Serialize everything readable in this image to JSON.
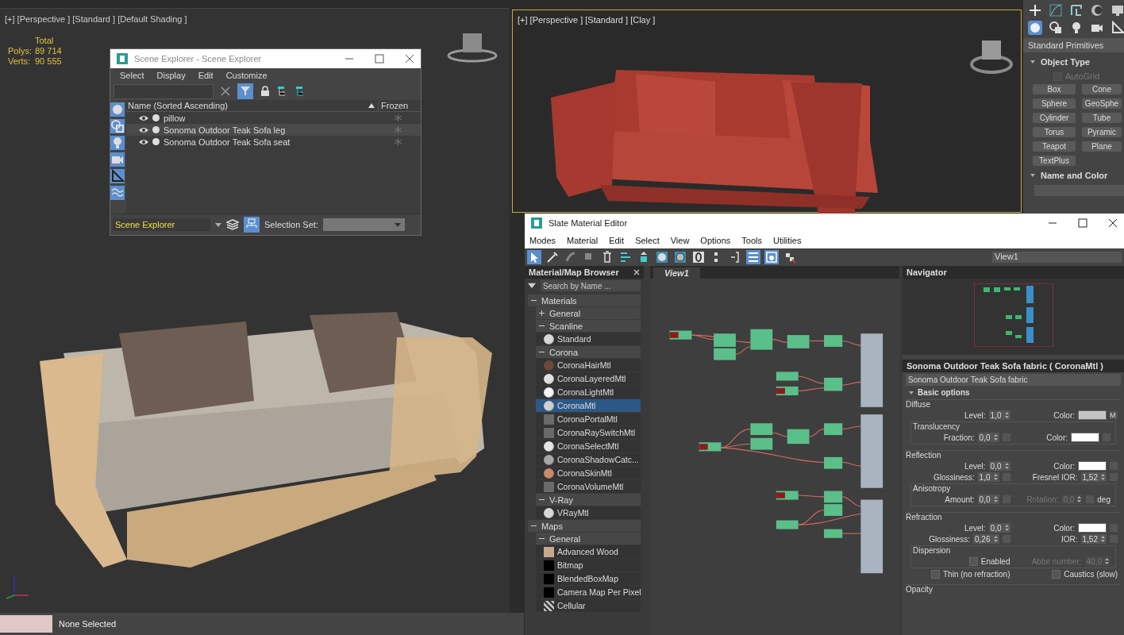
{
  "viewports": [
    {
      "label": "[+] [Perspective ] [Standard ] [Default Shading ]",
      "active": false
    },
    {
      "label": "[+] [Perspective ] [Standard ] [Clay ]",
      "active": true
    }
  ],
  "stats": {
    "heading": "Total",
    "rows": [
      {
        "label": "Polys:",
        "value": "89 714"
      },
      {
        "label": "Verts:",
        "value": "90 555"
      }
    ]
  },
  "scene_explorer": {
    "title": "Scene Explorer - Scene Explorer",
    "menu": [
      "Select",
      "Display",
      "Edit",
      "Customize"
    ],
    "filter_active": true,
    "columns": [
      "Name (Sorted Ascending)",
      "Frozen"
    ],
    "rows": [
      {
        "name": "pillow",
        "selected": false
      },
      {
        "name": "Sonoma Outdoor Teak Sofa leg",
        "selected": true
      },
      {
        "name": "Sonoma Outdoor Teak Sofa seat",
        "selected": false
      }
    ],
    "explorer_name": "Scene Explorer",
    "selection_set_label": "Selection Set:"
  },
  "command_panel": {
    "dropdown": "Standard Primitives",
    "object_type": {
      "title": "Object Type",
      "expanded": true,
      "autogrid": {
        "label": "AutoGrid",
        "checked": false,
        "disabled": true
      },
      "buttons": [
        "Box",
        "Cone",
        "Sphere",
        "GeoSphe",
        "Cylinder",
        "Tube",
        "Torus",
        "Pyramic",
        "Teapot",
        "Plane",
        "TextPlus"
      ]
    },
    "name_and_color": {
      "title": "Name and Color",
      "expanded": true
    }
  },
  "slate": {
    "title": "Slate Material Editor",
    "menu": [
      "Modes",
      "Material",
      "Edit",
      "Select",
      "View",
      "Options",
      "Tools",
      "Utilities"
    ],
    "view_dropdown": "View1",
    "browser": {
      "title": "Material/Map Browser",
      "search_placeholder": "Search by Name ...",
      "sections": [
        {
          "label": "Materials",
          "expanded": true,
          "groups": [
            {
              "label": "General",
              "expanded": false
            },
            {
              "label": "Scanline",
              "expanded": true,
              "items": [
                {
                  "name": "Standard",
                  "kind": "sphere",
                  "color": "#d8d8d8",
                  "selected": false
                }
              ]
            },
            {
              "label": "Corona",
              "expanded": true,
              "items": [
                {
                  "name": "CoronaHairMtl",
                  "kind": "sphere",
                  "color": "#6b4a3a",
                  "selected": false
                },
                {
                  "name": "CoronaLayeredMtl",
                  "kind": "sphere",
                  "color": "#e0e0e0",
                  "selected": false
                },
                {
                  "name": "CoronaLightMtl",
                  "kind": "sphere",
                  "color": "#f4f4f4",
                  "selected": false
                },
                {
                  "name": "CoronaMtl",
                  "kind": "sphere",
                  "color": "#d0d0d0",
                  "selected": true
                },
                {
                  "name": "CoronaPortalMtl",
                  "kind": "flat",
                  "color": "#6a6a6a",
                  "selected": false
                },
                {
                  "name": "CoronaRaySwitchMtl",
                  "kind": "flat",
                  "color": "#6a6a6a",
                  "selected": false
                },
                {
                  "name": "CoronaSelectMtl",
                  "kind": "sphere",
                  "color": "#e4e4e4",
                  "selected": false
                },
                {
                  "name": "CoronaShadowCatc...",
                  "kind": "sphere",
                  "color": "#a8a8a8",
                  "selected": false
                },
                {
                  "name": "CoronaSkinMtl",
                  "kind": "sphere",
                  "color": "#c98a6a",
                  "selected": false
                },
                {
                  "name": "CoronaVolumeMtl",
                  "kind": "flat",
                  "color": "#6a6a6a",
                  "selected": false
                }
              ]
            },
            {
              "label": "V-Ray",
              "expanded": true,
              "items": [
                {
                  "name": "VRayMtl",
                  "kind": "sphere",
                  "color": "#d8d8d8",
                  "selected": false
                }
              ]
            }
          ]
        },
        {
          "label": "Maps",
          "expanded": true,
          "groups": [
            {
              "label": "General",
              "expanded": true,
              "items": [
                {
                  "name": "Advanced Wood",
                  "kind": "flat",
                  "color": "#c8a88a",
                  "selected": false
                },
                {
                  "name": "Bitmap",
                  "kind": "flat",
                  "color": "#000000",
                  "selected": false
                },
                {
                  "name": "BlendedBoxMap",
                  "kind": "flat",
                  "color": "#000000",
                  "selected": false
                },
                {
                  "name": "Camera Map Per Pixel",
                  "kind": "flat",
                  "color": "#000000",
                  "selected": false
                },
                {
                  "name": "Cellular",
                  "kind": "checker",
                  "color": "#bbbbbb",
                  "selected": false
                }
              ]
            }
          ]
        }
      ]
    },
    "view_tab": "View1",
    "navigator_title": "Navigator",
    "params": {
      "title": "Sonoma Outdoor Teak Sofa fabric  ( CoronaMtl )",
      "name_field": "Sonoma Outdoor Teak Sofa fabric",
      "rollout": "Basic options",
      "groups": [
        {
          "title": "Diffuse",
          "rows": [
            [
              {
                "kind": "spinner",
                "label": "Level:",
                "value": "1,0",
                "disabled": false
              },
              {
                "kind": "color",
                "label": "Color:",
                "color": "#c4c4c4",
                "map": "M"
              }
            ]
          ],
          "sub": {
            "title": "Translucency",
            "rows": [
              [
                {
                  "kind": "spinner",
                  "label": "Fraction:",
                  "value": "0,0",
                  "disabled": false,
                  "slot": true
                },
                {
                  "kind": "color",
                  "label": "Color:",
                  "color": "#ffffff"
                }
              ]
            ]
          }
        },
        {
          "title": "Reflection",
          "rows": [
            [
              {
                "kind": "spinner",
                "label": "Level:",
                "value": "0,0",
                "disabled": false
              },
              {
                "kind": "color",
                "label": "Color:",
                "color": "#ffffff"
              }
            ],
            [
              {
                "kind": "spinner",
                "label": "Glossiness:",
                "value": "1,0",
                "disabled": false,
                "slot": true
              },
              {
                "kind": "spinner",
                "label": "Fresnel IOR:",
                "value": "1,52",
                "disabled": false,
                "slot": true
              }
            ]
          ],
          "sub": {
            "title": "Anisotropy",
            "rows": [
              [
                {
                  "kind": "spinner",
                  "label": "Amount:",
                  "value": "0,0",
                  "disabled": false,
                  "slot": true
                },
                {
                  "kind": "spinner",
                  "label": "Rotation:",
                  "value": "0,0",
                  "disabled": true,
                  "slot": true,
                  "unit": "deg"
                }
              ]
            ]
          }
        },
        {
          "title": "Refraction",
          "rows": [
            [
              {
                "kind": "spinner",
                "label": "Level:",
                "value": "0,0",
                "disabled": false
              },
              {
                "kind": "color",
                "label": "Color:",
                "color": "#ffffff"
              }
            ],
            [
              {
                "kind": "spinner",
                "label": "Glossiness:",
                "value": "0,26",
                "disabled": false,
                "slot": true
              },
              {
                "kind": "spinner",
                "label": "IOR:",
                "value": "1,52",
                "disabled": false,
                "slot": true
              }
            ]
          ],
          "sub": {
            "title": "Dispersion",
            "rows": [
              [
                {
                  "kind": "check",
                  "label": "Enabled",
                  "checked": false
                },
                {
                  "kind": "spinner",
                  "label": "Abbe number:",
                  "value": "40,0",
                  "disabled": true
                }
              ]
            ]
          },
          "after": [
            [
              {
                "kind": "check",
                "label": "Thin (no refraction)",
                "checked": false
              },
              {
                "kind": "check",
                "label": "Caustics (slow)",
                "checked": false
              }
            ]
          ]
        },
        {
          "title": "Opacity"
        }
      ]
    }
  },
  "status": {
    "text": "None Selected"
  }
}
